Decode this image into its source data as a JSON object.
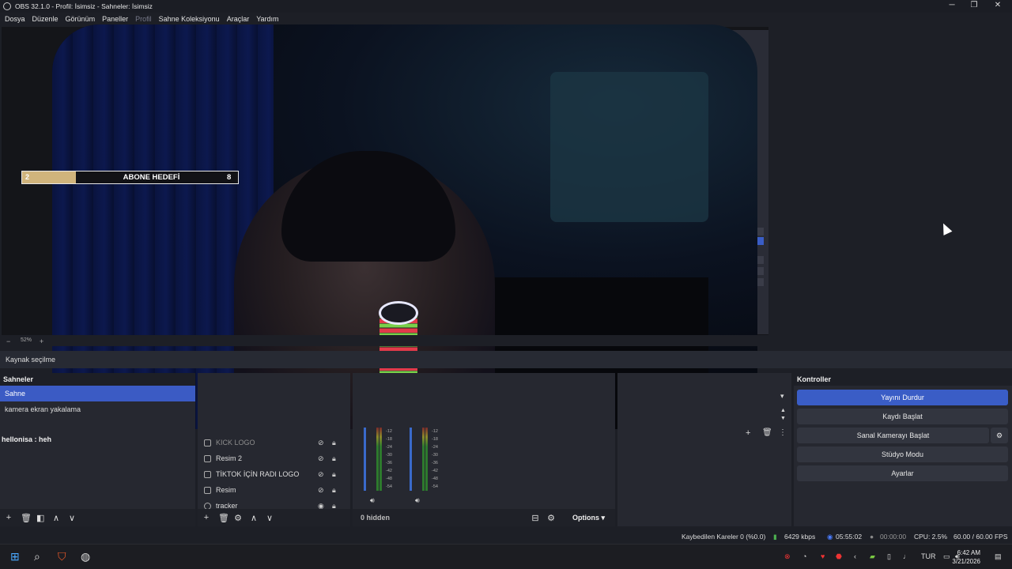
{
  "window": {
    "title": "OBS 32.1.0 - Profil: İsimsiz - Sahneler: İsimsiz",
    "minimize": "─",
    "maximize": "❐",
    "close": "✕"
  },
  "menu": [
    "Dosya",
    "Düzenle",
    "Görünüm",
    "Paneller",
    "Profil",
    "Sahne Koleksiyonu",
    "Araçlar",
    "Yardım"
  ],
  "menu_disabled_index": 4,
  "overlay": {
    "goal_current": "2",
    "goal_label": "ABONE HEDEFİ",
    "goal_max": "8",
    "goal_fill_fraction": 0.25
  },
  "zoom": {
    "minus": "−",
    "level": "52%",
    "plus": "+"
  },
  "source_bar": {
    "text": "Kaynak seçilme"
  },
  "scenes": {
    "title": "Sahneler",
    "items": [
      "Sahne",
      "kamera ekran yakalama"
    ],
    "active_index": 0,
    "chat_line": "hellonisa : heh"
  },
  "sources": {
    "items": [
      {
        "name": "KICK LOGO",
        "visible": false
      },
      {
        "name": "Resim 2",
        "visible": false
      },
      {
        "name": "TİKTOK İÇİN RADI LOGO",
        "visible": false
      },
      {
        "name": "Resim",
        "visible": false
      },
      {
        "name": "tracker",
        "visible": true
      }
    ]
  },
  "mixer": {
    "scale": [
      "-12",
      "-18",
      "-24",
      "-30",
      "-36",
      "-42",
      "-48",
      "-54",
      "-60"
    ],
    "hidden_label": "0 hidden",
    "options_label": "Options"
  },
  "controls": {
    "title": "Kontroller",
    "stop_stream": "Yayını Durdur",
    "start_record": "Kaydı Başlat",
    "virtual_cam": "Sanal Kamerayı Başlat",
    "studio_mode": "Stüdyo Modu",
    "settings": "Ayarlar"
  },
  "status": {
    "dropped": "Kaybedilen Kareler 0 (%0.0)",
    "bitrate": "6429 kbps",
    "stream_time": "05:55:02",
    "record_time": "00:00:00",
    "cpu": "CPU: 2.5%",
    "fps": "60.00 / 60.00 FPS"
  },
  "taskbar": {
    "lang": "TUR",
    "time": "6:42 AM",
    "date": "3/21/2026"
  },
  "colors": {
    "accent": "#3a5dc6",
    "goal_fill": "#d0b47c"
  }
}
